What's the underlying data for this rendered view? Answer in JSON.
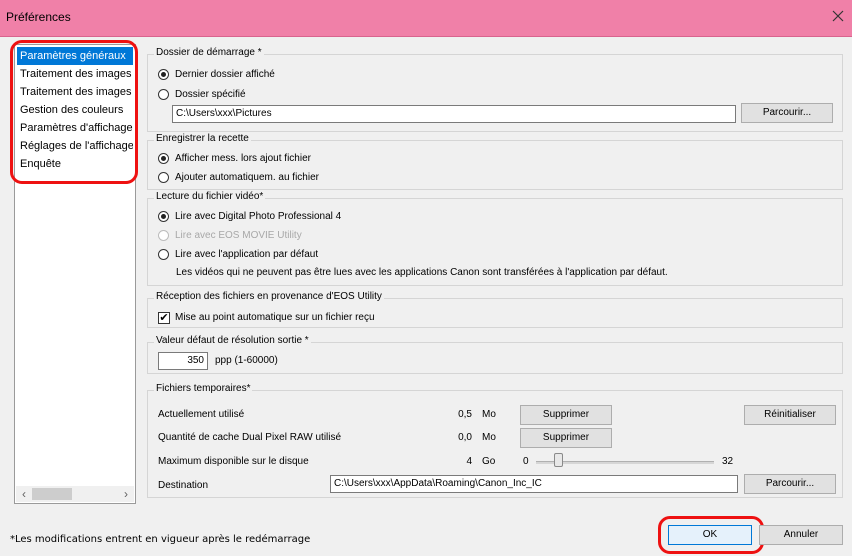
{
  "window": {
    "title": "Préférences"
  },
  "sidebar": {
    "items": [
      {
        "label": "Paramètres généraux",
        "selected": true
      },
      {
        "label": "Traitement des images"
      },
      {
        "label": "Traitement des images"
      },
      {
        "label": "Gestion des couleurs"
      },
      {
        "label": "Paramètres d'affichage"
      },
      {
        "label": "Réglages de l'affichage"
      },
      {
        "label": "Enquête"
      }
    ]
  },
  "startup": {
    "legend": "Dossier de démarrage *",
    "opt_last": "Dernier dossier affiché",
    "opt_specific": "Dossier spécifié",
    "path": "C:\\Users\\xxx\\Pictures",
    "browse": "Parcourir..."
  },
  "recipe": {
    "legend": "Enregistrer la recette",
    "opt_show": "Afficher mess. lors ajout fichier",
    "opt_auto": "Ajouter automatiquem. au fichier"
  },
  "video": {
    "legend": "Lecture du fichier vidéo*",
    "opt_dpp": "Lire avec Digital Photo Professional 4",
    "opt_movie": "Lire avec EOS MOVIE Utility",
    "opt_default": "Lire avec l'application par défaut",
    "note": "Les vidéos qui ne peuvent pas être lues avec les applications Canon sont transférées à l'application par défaut."
  },
  "reception": {
    "legend": "Réception des fichiers en provenance d'EOS Utility",
    "autofocus": "Mise au point automatique sur un fichier reçu",
    "check_mark": "✔"
  },
  "resolution": {
    "legend": "Valeur défaut de résolution sortie *",
    "value": "350",
    "unit": "ppp (1-60000)"
  },
  "temp": {
    "legend": "Fichiers temporaires*",
    "current_label": "Actuellement utilisé",
    "current_value": "0,5",
    "current_unit": "Mo",
    "delete1": "Supprimer",
    "reset": "Réinitialiser",
    "cache_label": "Quantité de cache Dual Pixel RAW utilisé",
    "cache_value": "0,0",
    "cache_unit": "Mo",
    "delete2": "Supprimer",
    "max_label": "Maximum disponible sur le disque",
    "max_value": "4",
    "max_unit": "Go",
    "slider_min": "0",
    "slider_max": "32",
    "slider_value": 4,
    "dest_label": "Destination",
    "dest_path": "C:\\Users\\xxx\\AppData\\Roaming\\Canon_Inc_IC",
    "browse": "Parcourir..."
  },
  "footer": {
    "note": "*Les modifications entrent en vigueur après le redémarrage",
    "ok": "OK",
    "cancel": "Annuler"
  },
  "colors": {
    "title_bar": "#f080a8",
    "selection": "#0078d7",
    "highlight": "#e11111"
  }
}
